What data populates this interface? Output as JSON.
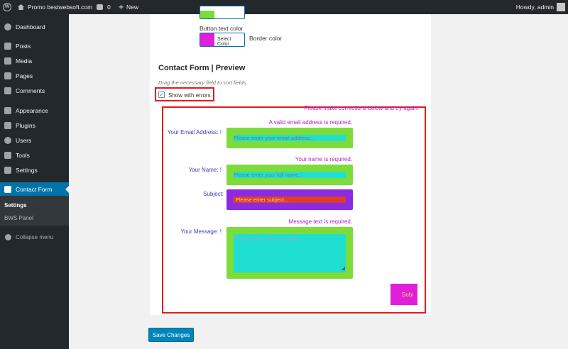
{
  "adminbar": {
    "site_name": "Promo bestwebsoft.com",
    "comments_count": "0",
    "new_label": "New",
    "howdy": "Howdy, admin"
  },
  "sidebar": {
    "items": [
      {
        "label": "Dashboard",
        "icon": "dashboard-icon"
      },
      {
        "label": "Posts",
        "icon": "pin-icon"
      },
      {
        "label": "Media",
        "icon": "media-icon"
      },
      {
        "label": "Pages",
        "icon": "pages-icon"
      },
      {
        "label": "Comments",
        "icon": "comments-icon"
      },
      {
        "label": "Appearance",
        "icon": "brush-icon"
      },
      {
        "label": "Plugins",
        "icon": "plug-icon"
      },
      {
        "label": "Users",
        "icon": "users-icon"
      },
      {
        "label": "Tools",
        "icon": "wrench-icon"
      },
      {
        "label": "Settings",
        "icon": "settings-icon"
      },
      {
        "label": "Contact Form",
        "icon": "envelope-icon"
      }
    ],
    "submenu": [
      "Settings",
      "BWS Panel"
    ],
    "collapse": "Collapse menu"
  },
  "settings": {
    "button_text_color_label": "Button text color",
    "select_color": "Select Color",
    "border_color_label": "Border color",
    "section_title": "Contact Form | Preview",
    "drag_hint": "Drag the necessary field to sort fields.",
    "show_errors_label": "Show with errors",
    "show_errors_checked": true
  },
  "preview": {
    "top_error": "Please make corrections below and try again.",
    "email": {
      "error": "A valid email address is required.",
      "label": "Your Email Address:",
      "required": "!",
      "placeholder": "Please enter your email address..."
    },
    "name": {
      "error": "Your name is required.",
      "label": "Your Name:",
      "required": "!",
      "placeholder": "Please enter your full name..."
    },
    "subject": {
      "label": "Subject:",
      "placeholder": "Please enter subject..."
    },
    "message": {
      "error": "Message text is required.",
      "label": "Your Message:",
      "required": "!",
      "placeholder": "Please enter your message..."
    },
    "submit": "Subi"
  },
  "save_button": "Save Changes",
  "colors": {
    "admin_bar": "#23282d",
    "accent": "#0073aa",
    "field_border": "#7ddc3a",
    "field_bg": "#1fe0d0",
    "subject_border": "#8a2be2",
    "subject_bg": "#e03c2a",
    "submit_bg": "#e01fd8",
    "error_text": "#b31fc9",
    "label_text": "#3a3cc4",
    "highlight": "#e41b1b"
  }
}
